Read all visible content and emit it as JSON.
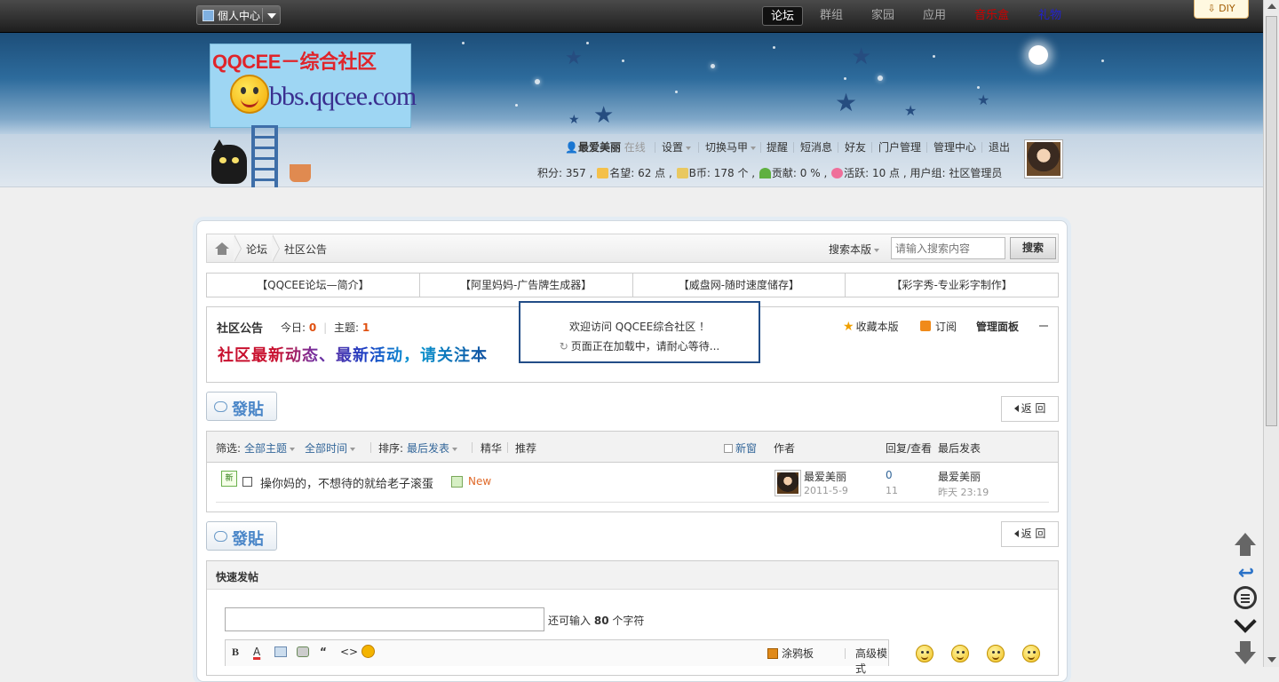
{
  "topbar": {
    "personal_center": "個人中心",
    "nav": [
      "论坛",
      "群组",
      "家园",
      "应用",
      "音乐盒",
      "礼物"
    ],
    "nav_colors": {
      "music": "#cc0000",
      "gift": "#2222cc"
    },
    "diy": "DIY"
  },
  "logo": {
    "title": "QQCEE－综合社区",
    "url": "bbs.qqcee.com"
  },
  "user": {
    "name": "最爱美丽",
    "status": "在线",
    "links": [
      "设置",
      "切换马甲",
      "提醒",
      "短消息",
      "好友",
      "门户管理",
      "管理中心",
      "退出"
    ],
    "stats": {
      "points_label": "积分: 357 ,",
      "reputation": "名望: 62 点 ,",
      "bcoin": "B币: 178 个 ,",
      "contribution": "贡献: 0 % ,",
      "activity": "活跃: 10 点 ,",
      "group": "用户组: 社区管理员"
    }
  },
  "breadcrumb": {
    "items": [
      "论坛",
      "社区公告"
    ],
    "search_scope": "搜索本版",
    "search_placeholder": "请输入搜索内容",
    "search_button": "搜索"
  },
  "quick_links": [
    "【QQCEE论坛—简介】",
    "【阿里妈妈-广告牌生成器】",
    "【威盘网-随时速度储存】",
    "【彩字秀-专业彩字制作】"
  ],
  "forum": {
    "title": "社区公告",
    "today_label": "今日:",
    "today_value": "0",
    "topics_label": "主题:",
    "topics_value": "1",
    "banner": "社区最新动态、最新活动，请关注本",
    "favorite": "收藏本版",
    "subscribe": "订阅",
    "admin_panel": "管理面板"
  },
  "loading": {
    "line1": "欢迎访问 QQCEE综合社区 ！",
    "line2": "页面正在加载中，请耐心等待..."
  },
  "buttons": {
    "post": "發貼",
    "back": "返 回"
  },
  "thread_list": {
    "filter_label": "筛选:",
    "all_topics": "全部主题",
    "all_time": "全部时间",
    "sort_label": "排序:",
    "sort_value": "最后发表",
    "digest": "精华",
    "recommend": "推荐",
    "new_window": "新窗",
    "col_author": "作者",
    "col_replies": "回复/查看",
    "col_last": "最后发表",
    "rows": [
      {
        "icon": "新",
        "title": "操你妈的，不想待的就给老子滚蛋",
        "tag": "New",
        "author": "最爱美丽",
        "date": "2011-5-9",
        "replies": "0",
        "views": "11",
        "last_author": "最爱美丽",
        "last_time": "昨天 23:19"
      }
    ]
  },
  "quick_post": {
    "title": "快速发帖",
    "count_prefix": "还可输入",
    "count_value": "80",
    "count_suffix": "个字符",
    "toolbar": {
      "bold": "B",
      "color": "A",
      "quote": "“",
      "code": "<>",
      "graffiti": "涂鸦板",
      "advanced": "高级模式"
    }
  }
}
